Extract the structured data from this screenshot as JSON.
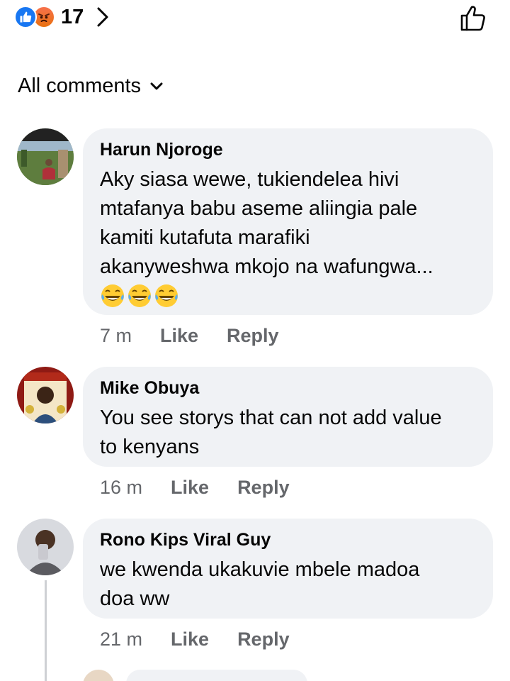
{
  "reactions": {
    "count": "17",
    "types": [
      "like-icon",
      "angry-icon"
    ],
    "like_color": "#1877f2",
    "angry_color": "#f26d3d"
  },
  "sort": {
    "label": "All comments"
  },
  "comments": [
    {
      "author": "Harun Njoroge",
      "lines": [
        "Aky siasa wewe, tukiendelea hivi",
        "mtafanya babu aseme aliingia pale",
        "kamiti kutafuta marafiki",
        "akanyweshwa mkojo na wafungwa..."
      ],
      "emojis": [
        "laughing-tears-emoji",
        "laughing-tears-emoji",
        "laughing-tears-emoji"
      ],
      "time": "7 m",
      "like_label": "Like",
      "reply_label": "Reply"
    },
    {
      "author": "Mike Obuya",
      "lines": [
        "You see storys that can not add value",
        "to kenyans"
      ],
      "time": "16 m",
      "like_label": "Like",
      "reply_label": "Reply"
    },
    {
      "author": "Rono Kips Viral Guy",
      "lines": [
        "we kwenda ukakuvie mbele madoa",
        "doa ww"
      ],
      "time": "21 m",
      "like_label": "Like",
      "reply_label": "Reply"
    }
  ],
  "colors": {
    "bubble": "#f0f2f5",
    "meta_text": "#65676b",
    "text": "#050505"
  }
}
